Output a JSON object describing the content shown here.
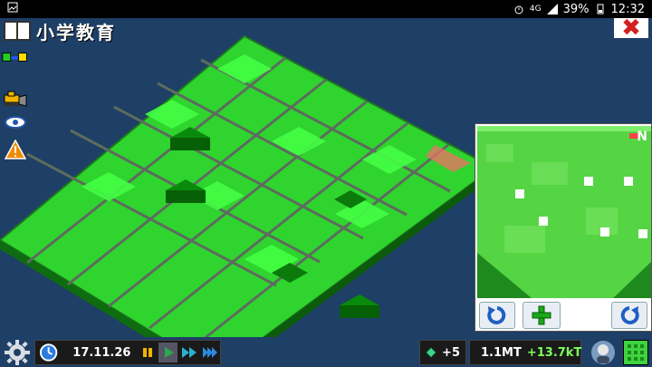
{
  "status_bar": {
    "battery": "39%",
    "time": "12:32",
    "network": "4G"
  },
  "header": {
    "city_name": "小学教育"
  },
  "icons": {
    "book": "book-icon",
    "layers": "layers-icon",
    "bulldozer": "bulldozer-icon",
    "eye": "eye-icon",
    "warning": "warning-icon",
    "close": "close-icon",
    "settings": "gear-icon",
    "clock": "clock-icon",
    "diamond": "diamond-icon",
    "coins": "coins-icon"
  },
  "close_label": "✖",
  "minimap": {
    "north_label": "N"
  },
  "bottom_bar": {
    "date": "17.11.26",
    "diamonds": "+5",
    "money": "1.1MT",
    "income": "+13.7kT"
  },
  "colors": {
    "water": "#1e3f66",
    "zone_green": "#22ee22",
    "road": "#5e6b5e",
    "accent_red": "#d32020"
  }
}
